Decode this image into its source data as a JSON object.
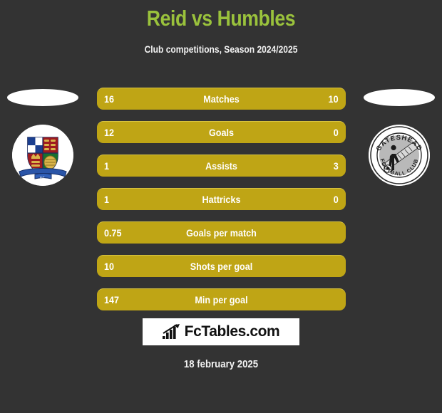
{
  "header": {
    "title": "Reid vs Humbles",
    "subtitle": "Club competitions, Season 2024/2025",
    "title_color": "#9ac23c"
  },
  "theme": {
    "background": "#333333",
    "bar_color": "#bfa515",
    "bar_highlight": "#d8c441",
    "text_color": "#ffffff"
  },
  "crests": {
    "left": {
      "name": "left-club-crest",
      "alt": "heraldic quartered shield club crest"
    },
    "right": {
      "name": "right-club-crest",
      "alt": "Gateshead Football Club crest",
      "top_text": "GATESHEAD",
      "bottom_text": "FOOTBALL CLUB"
    }
  },
  "stats": [
    {
      "label": "Matches",
      "left": "16",
      "right": "10"
    },
    {
      "label": "Goals",
      "left": "12",
      "right": "0"
    },
    {
      "label": "Assists",
      "left": "1",
      "right": "3"
    },
    {
      "label": "Hattricks",
      "left": "1",
      "right": "0"
    },
    {
      "label": "Goals per match",
      "left": "0.75",
      "right": ""
    },
    {
      "label": "Shots per goal",
      "left": "10",
      "right": ""
    },
    {
      "label": "Min per goal",
      "left": "147",
      "right": ""
    }
  ],
  "footer": {
    "logo_text": "FcTables.com",
    "logo_icon": "bar-chart-arrow-icon",
    "date": "18 february 2025"
  }
}
